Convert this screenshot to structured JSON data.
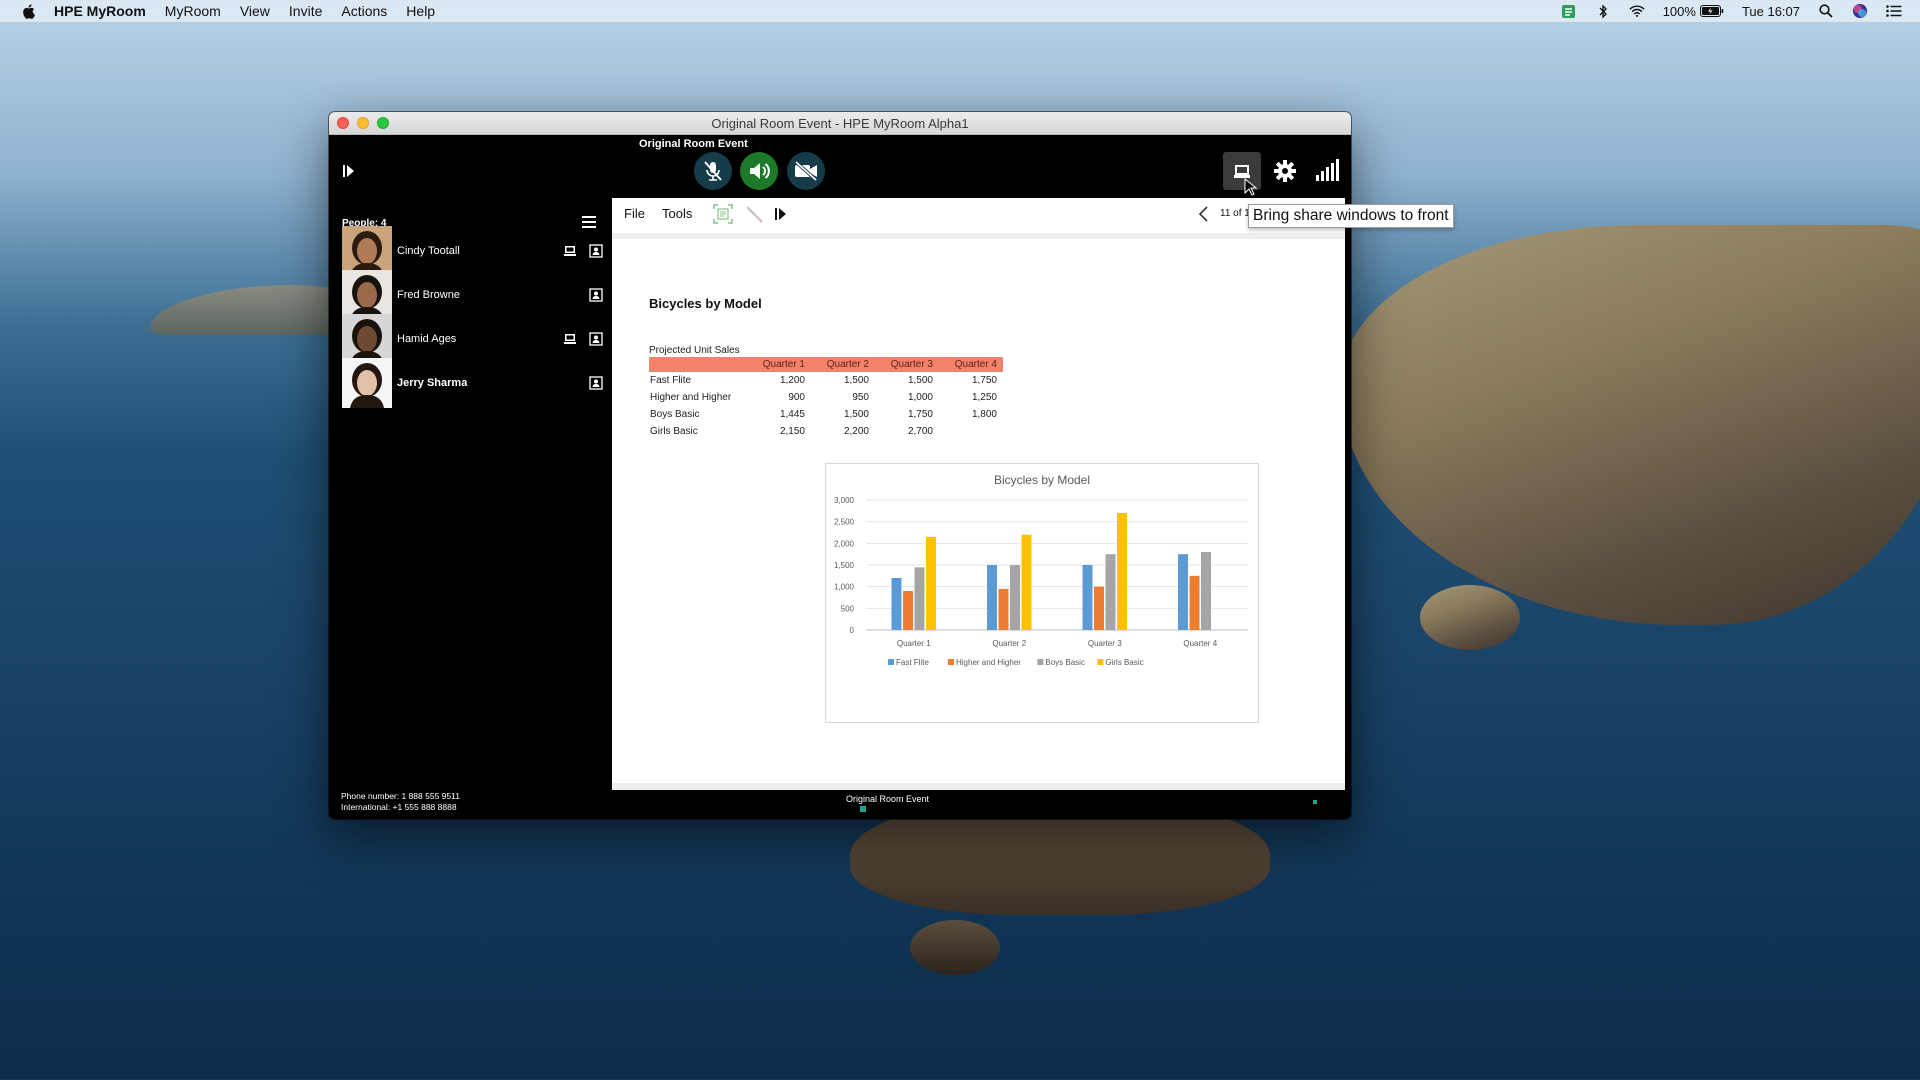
{
  "menubar": {
    "app_name": "HPE MyRoom",
    "items": [
      "MyRoom",
      "View",
      "Invite",
      "Actions",
      "Help"
    ],
    "battery": "100%",
    "clock": "Tue 16:07"
  },
  "window": {
    "title": "Original Room Event - HPE MyRoom Alpha1",
    "room_name": "Original Room Event"
  },
  "people": {
    "count_label": "People: 4",
    "list": [
      {
        "name": "Cindy Tootall",
        "sharing": true,
        "skin": "#b07a55",
        "hair": "#2a1a10",
        "bg": "#c9a47a"
      },
      {
        "name": "Fred Browne",
        "sharing": false,
        "skin": "#9a6a4a",
        "hair": "#1a120c",
        "bg": "#e9e6e2"
      },
      {
        "name": "Hamid Ages",
        "sharing": true,
        "skin": "#6e4a33",
        "hair": "#1a120c",
        "bg": "#d6d6d6"
      },
      {
        "name": "Jerry Sharma",
        "sharing": false,
        "skin": "#e2c2a6",
        "hair": "#24170f",
        "bg": "#f5f5f5"
      }
    ],
    "phone_line": "Phone number: 1 888 555 9511",
    "international_line": "International:  +1 555 888 8888"
  },
  "share": {
    "menu_file": "File",
    "menu_tools": "Tools",
    "page_counter": "11 of 1",
    "doc_title": "Bicycles by Model",
    "table_caption": "Projected Unit Sales",
    "table_headers": [
      "",
      "Quarter 1",
      "Quarter 2",
      "Quarter 3",
      "Quarter 4"
    ],
    "table_rows": [
      [
        "Fast Flite",
        "1,200",
        "1,500",
        "1,500",
        "1,750"
      ],
      [
        "Higher and Higher",
        "900",
        "950",
        "1,000",
        "1,250"
      ],
      [
        "Boys Basic",
        "1,445",
        "1,500",
        "1,750",
        "1,800"
      ],
      [
        "Girls Basic",
        "2,150",
        "2,200",
        "2,700",
        ""
      ]
    ]
  },
  "chart_data": {
    "type": "bar",
    "title": "Bicycles by Model",
    "categories": [
      "Quarter 1",
      "Quarter 2",
      "Quarter 3",
      "Quarter 4"
    ],
    "ylim": [
      0,
      3000
    ],
    "yticks": [
      0,
      500,
      1000,
      1500,
      2000,
      2500,
      3000
    ],
    "ytick_labels": [
      "0",
      "500",
      "1,000",
      "1,500",
      "2,000",
      "2,500",
      "3,000"
    ],
    "grid": true,
    "legend_position": "bottom",
    "series": [
      {
        "name": "Fast Flite",
        "color": "#5b9bd5",
        "values": [
          1200,
          1500,
          1500,
          1750
        ]
      },
      {
        "name": "Higher and Higher",
        "color": "#ed7d31",
        "values": [
          900,
          950,
          1000,
          1250
        ]
      },
      {
        "name": "Boys Basic",
        "color": "#a5a5a5",
        "values": [
          1445,
          1500,
          1750,
          1800
        ]
      },
      {
        "name": "Girls Basic",
        "color": "#ffc000",
        "values": [
          2150,
          2200,
          2700,
          0
        ]
      }
    ]
  },
  "tooltip": {
    "text": "Bring share windows to front"
  },
  "bottom": {
    "room_name": "Original Room Event"
  },
  "colors": {
    "speaker_active": "#1c7a2a",
    "muted_button": "#163c4a",
    "table_header": "#f4836b"
  }
}
